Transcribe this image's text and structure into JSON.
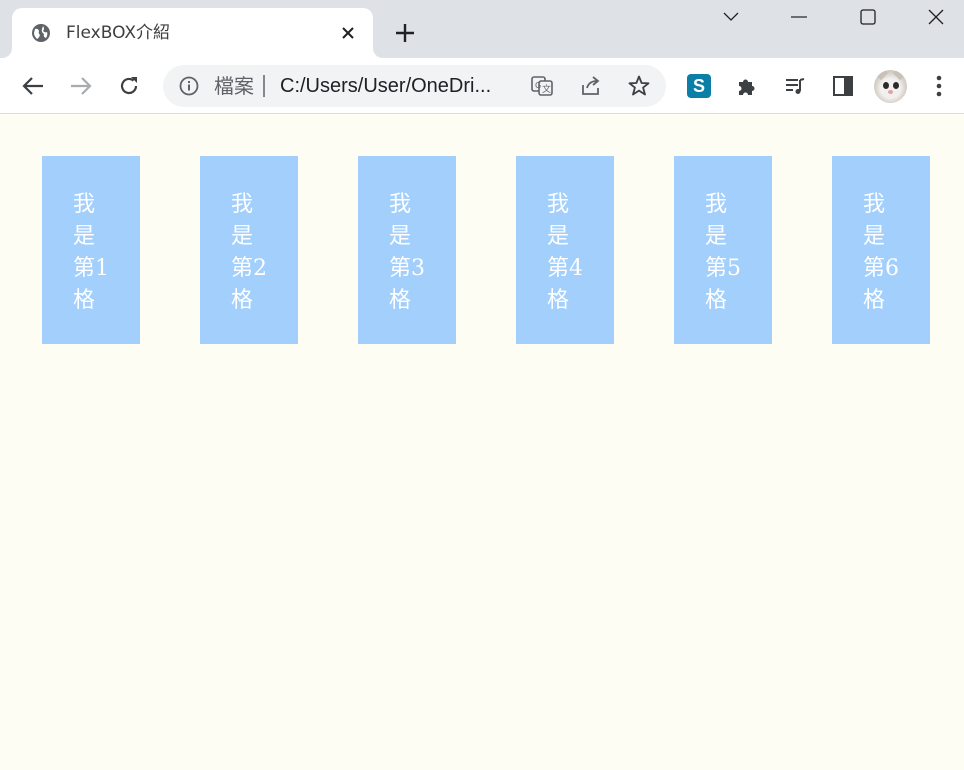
{
  "browser": {
    "tab": {
      "title": "FlexBOX介紹",
      "favicon": "globe-icon"
    },
    "window_controls": [
      "tab-search-icon",
      "minimize-icon",
      "maximize-icon",
      "close-icon"
    ],
    "toolbar": {
      "back": "back-arrow-icon",
      "forward": "forward-arrow-icon",
      "reload": "reload-icon",
      "omnibox": {
        "scheme_label": "檔案",
        "url": "C:/Users/User/OneDri..."
      },
      "extensions": [
        "translate-icon",
        "share-icon",
        "star-icon",
        "s-extension-icon",
        "puzzle-icon",
        "media-control-icon",
        "side-panel-icon",
        "avatar",
        "kebab-menu-icon"
      ],
      "s_extension_letter": "S"
    }
  },
  "page": {
    "items": [
      {
        "lines": [
          "我",
          "是",
          "第1",
          "格"
        ]
      },
      {
        "lines": [
          "我",
          "是",
          "第2",
          "格"
        ]
      },
      {
        "lines": [
          "我",
          "是",
          "第3",
          "格"
        ]
      },
      {
        "lines": [
          "我",
          "是",
          "第4",
          "格"
        ]
      },
      {
        "lines": [
          "我",
          "是",
          "第5",
          "格"
        ]
      },
      {
        "lines": [
          "我",
          "是",
          "第6",
          "格"
        ]
      }
    ],
    "colors": {
      "background": "#fdfdf4",
      "item_background": "#a2cffc",
      "item_text": "#ffffff"
    }
  }
}
